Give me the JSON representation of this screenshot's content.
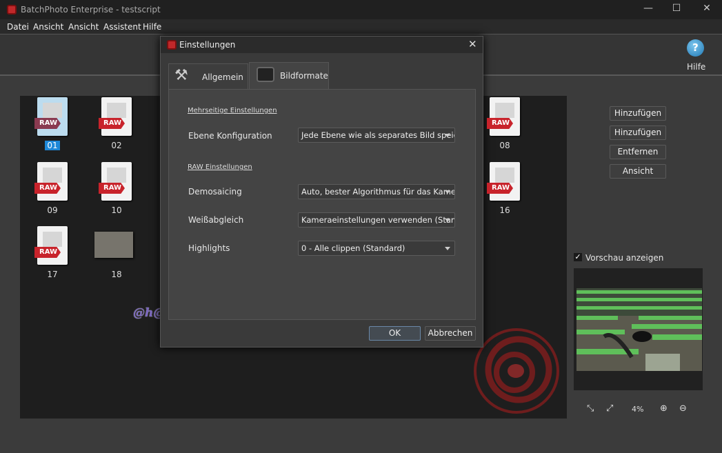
{
  "window": {
    "title": "BatchPhoto Enterprise - testscript",
    "controls": [
      "—",
      "☐",
      "✕"
    ]
  },
  "menu": [
    "Datei",
    "Ansicht",
    "Ansicht",
    "Assistent",
    "Hilfe"
  ],
  "toolbar": {
    "help_label": "Hilfe",
    "help_icon": "?"
  },
  "thumbnails": [
    {
      "label": "01",
      "selected": true,
      "type": "RAW"
    },
    {
      "label": "02",
      "type": "RAW"
    },
    {
      "label": "08",
      "type": "RAW"
    },
    {
      "label": "09",
      "type": "RAW"
    },
    {
      "label": "10",
      "type": "RAW"
    },
    {
      "label": "16",
      "type": "RAW"
    },
    {
      "label": "17",
      "type": "RAW"
    },
    {
      "label": "18",
      "type": "photo"
    }
  ],
  "watermark": "@h@design.eu",
  "dialog": {
    "title": "Einstellungen",
    "close": "✕",
    "tabs": [
      {
        "label": "Allgemein"
      },
      {
        "label": "Bildformate",
        "active": true
      }
    ],
    "section1": "Mehrseitige Einstellungen",
    "section2": "RAW Einstellungen",
    "fields": [
      {
        "label": "Ebene Konfiguration",
        "value": "Jede Ebene wie als separates Bild speichern"
      },
      {
        "label": "Demosaicing",
        "value": "Auto, bester Algorithmus für das Kameramodell"
      },
      {
        "label": "Weißabgleich",
        "value": "Kameraeinstellungen verwenden (Standard)"
      },
      {
        "label": "Highlights",
        "value": "0 - Alle clippen (Standard)"
      }
    ],
    "ok": "OK",
    "cancel": "Abbrechen"
  },
  "side_buttons": [
    "Hinzufügen",
    "Hinzufügen",
    "Entfernen",
    "Ansicht"
  ],
  "preview": {
    "checkbox_label": "Vorschau anzeigen",
    "checked": true,
    "zoom": "4%"
  }
}
